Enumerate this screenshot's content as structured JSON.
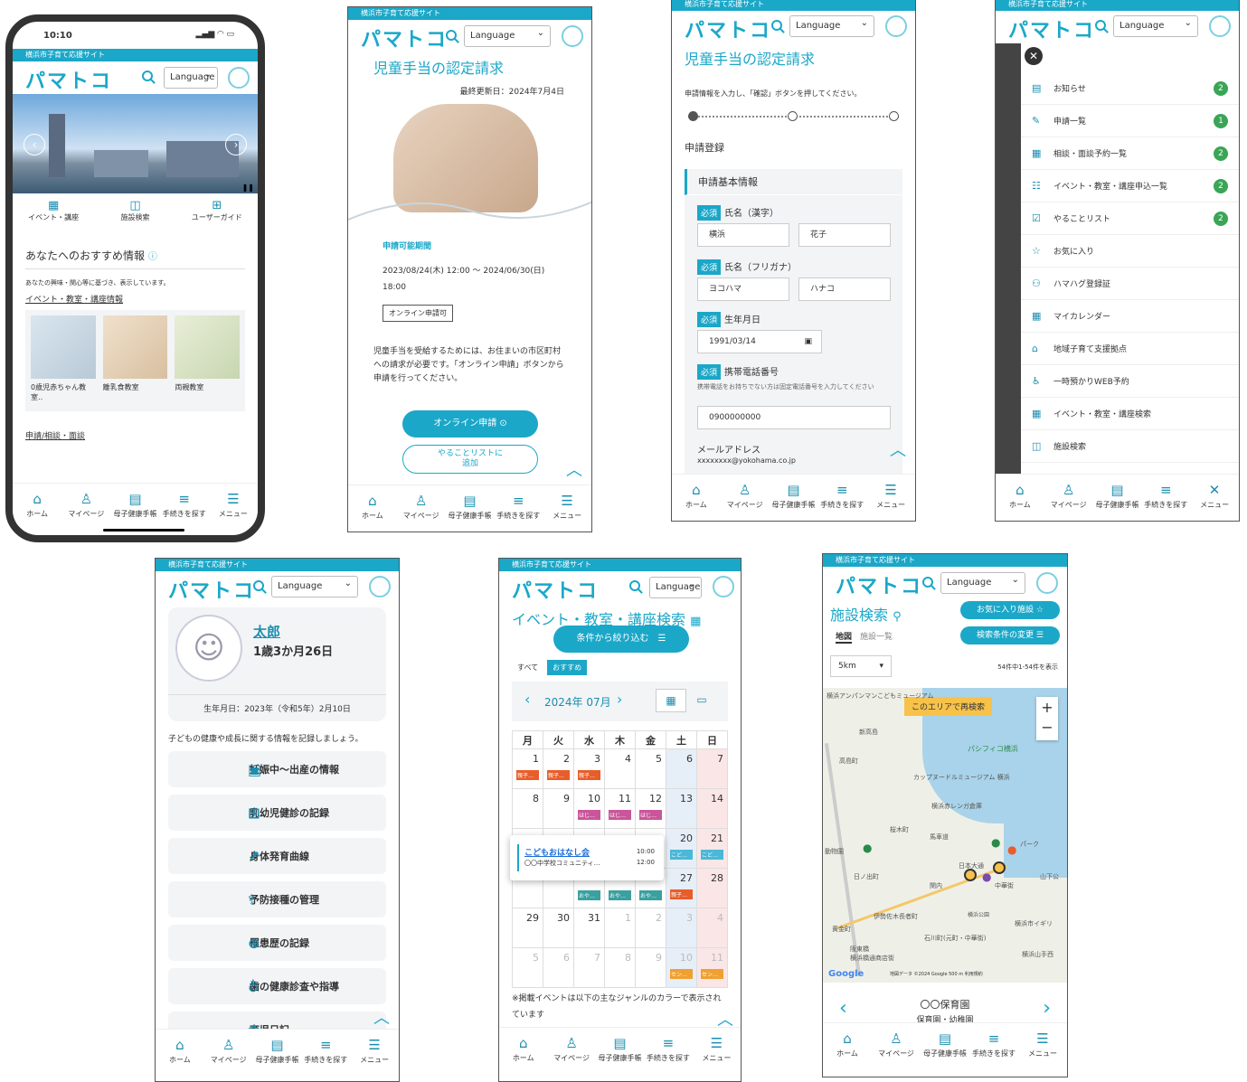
{
  "site": {
    "title_bar": "横浜市子育て応援サイト",
    "logo": "パマトコ",
    "lang": "Language"
  },
  "nav": [
    "ホーム",
    "マイページ",
    "母子健康手帳",
    "手続きを探す",
    "メニュー"
  ],
  "s1": {
    "time": "10:10",
    "menu": [
      "イベント・講座",
      "施設検索",
      "ユーザーガイド"
    ],
    "rec_title": "あなたへのおすすめ情報",
    "rec_desc": "あなたの興味・関心等に基づき、表示しています。",
    "link1": "イベント・教室・講座情報",
    "cards": [
      "0歳児赤ちゃん教室‥",
      "離乳食教室",
      "両親教室"
    ],
    "link2": "申請/相談・面談"
  },
  "s2": {
    "title": "児童手当の認定請求",
    "updated": "最終更新日：2024年7月4日",
    "period_label": "申請可能期間",
    "period": "2023/08/24(木) 12:00 〜 2024/06/30(日)",
    "period2": "18:00",
    "tag": "オンライン申請可",
    "desc": "児童手当を受給するためには、お住まいの市区町村への請求が必要です。「オンライン申請」ボタンから申請を行ってください。",
    "btn1": "オンライン申請",
    "btn2": "やることリストに\n追加"
  },
  "s3": {
    "title": "児童手当の認定請求",
    "instr": "申請情報を入力し、「確認」ボタンを押してください。",
    "sec": "申請登録",
    "sub": "申請基本情報",
    "req": "必須",
    "f1": "氏名（漢字）",
    "v1a": "横浜",
    "v1b": "花子",
    "f2": "氏名（フリガナ）",
    "v2a": "ヨコハマ",
    "v2b": "ハナコ",
    "f3": "生年月日",
    "v3": "1991/03/14",
    "f4": "携帯電話番号",
    "f4note": "携帯電話をお持ちでない方は固定電話番号を入力してください",
    "v4": "0900000000",
    "f5": "メールアドレス",
    "v5": "xxxxxxxx@yokohama.co.jp"
  },
  "s4": {
    "items": [
      {
        "label": "お知らせ",
        "badge": "2"
      },
      {
        "label": "申請一覧",
        "badge": "1"
      },
      {
        "label": "相談・面談予約一覧",
        "badge": "2"
      },
      {
        "label": "イベント・教室・講座申込一覧",
        "badge": "2"
      },
      {
        "label": "やることリスト",
        "badge": "2"
      },
      {
        "label": "お気に入り",
        "badge": ""
      },
      {
        "label": "ハマハグ登録証",
        "badge": ""
      },
      {
        "label": "マイカレンダー",
        "badge": ""
      },
      {
        "label": "地域子育て支援拠点",
        "badge": ""
      },
      {
        "label": "一時預かりWEB予約",
        "badge": ""
      },
      {
        "label": "イベント・教室・講座検索",
        "badge": ""
      },
      {
        "label": "施設検索",
        "badge": ""
      }
    ],
    "close_nav": "メニュー"
  },
  "s5": {
    "name": "太郎",
    "age": "1歳3か月26日",
    "birth": "生年月日：2023年（令和5年）2月10日",
    "intro": "子どもの健康や成長に関する情報を記録しましょう。",
    "records": [
      "妊娠中〜出産の情報",
      "乳幼児健診の記録",
      "身体発育曲線",
      "予防接種の管理",
      "罹患歴の記録",
      "歯の健康診査や指導",
      "育児日記"
    ]
  },
  "s6": {
    "title": "イベント・教室・講座検索",
    "filter": "条件から絞り込む",
    "tabs": [
      "すべて",
      "おすすめ"
    ],
    "month": "2024年 07月",
    "weekdays": [
      "月",
      "火",
      "水",
      "木",
      "金",
      "土",
      "日"
    ],
    "popup_title": "こどもおはなし会",
    "popup_place": "〇〇中学校コミュニティ…",
    "popup_t1": "10:00",
    "popup_t2": "12:00",
    "note": "※掲載イベントは以下の主なジャンルのカラーで表示されています"
  },
  "s7": {
    "title": "施設検索",
    "fav": "お気に入り施設",
    "change": "検索条件の変更",
    "tabs": [
      "地図",
      "施設一覧"
    ],
    "dist": "5km",
    "count": "54件中1-54件を表示",
    "research": "このエリアで再検索",
    "places": [
      "横浜アンパンマンこどもミュージアム",
      "新高島",
      "パシフィコ横浜",
      "カップヌードルミュージアム 横浜",
      "横浜赤レンガ倉庫",
      "桜木町",
      "馬車道",
      "日本大通",
      "中華街",
      "山下公",
      "関内",
      "伊勢佐木長者町",
      "石川町(元町・中華街)",
      "横浜市イギリ",
      "横浜山手西",
      "阪東橋",
      "横浜橋通商店街",
      "高島町",
      "動物園",
      "日ノ出町",
      "黄金町",
      "横浜公園",
      "パーク"
    ],
    "map_footer": "地図データ ©2024 Google   500 m   利用規約",
    "google": "Google",
    "facility": "〇〇保育園",
    "facility_type": "保育園・幼稚園"
  }
}
